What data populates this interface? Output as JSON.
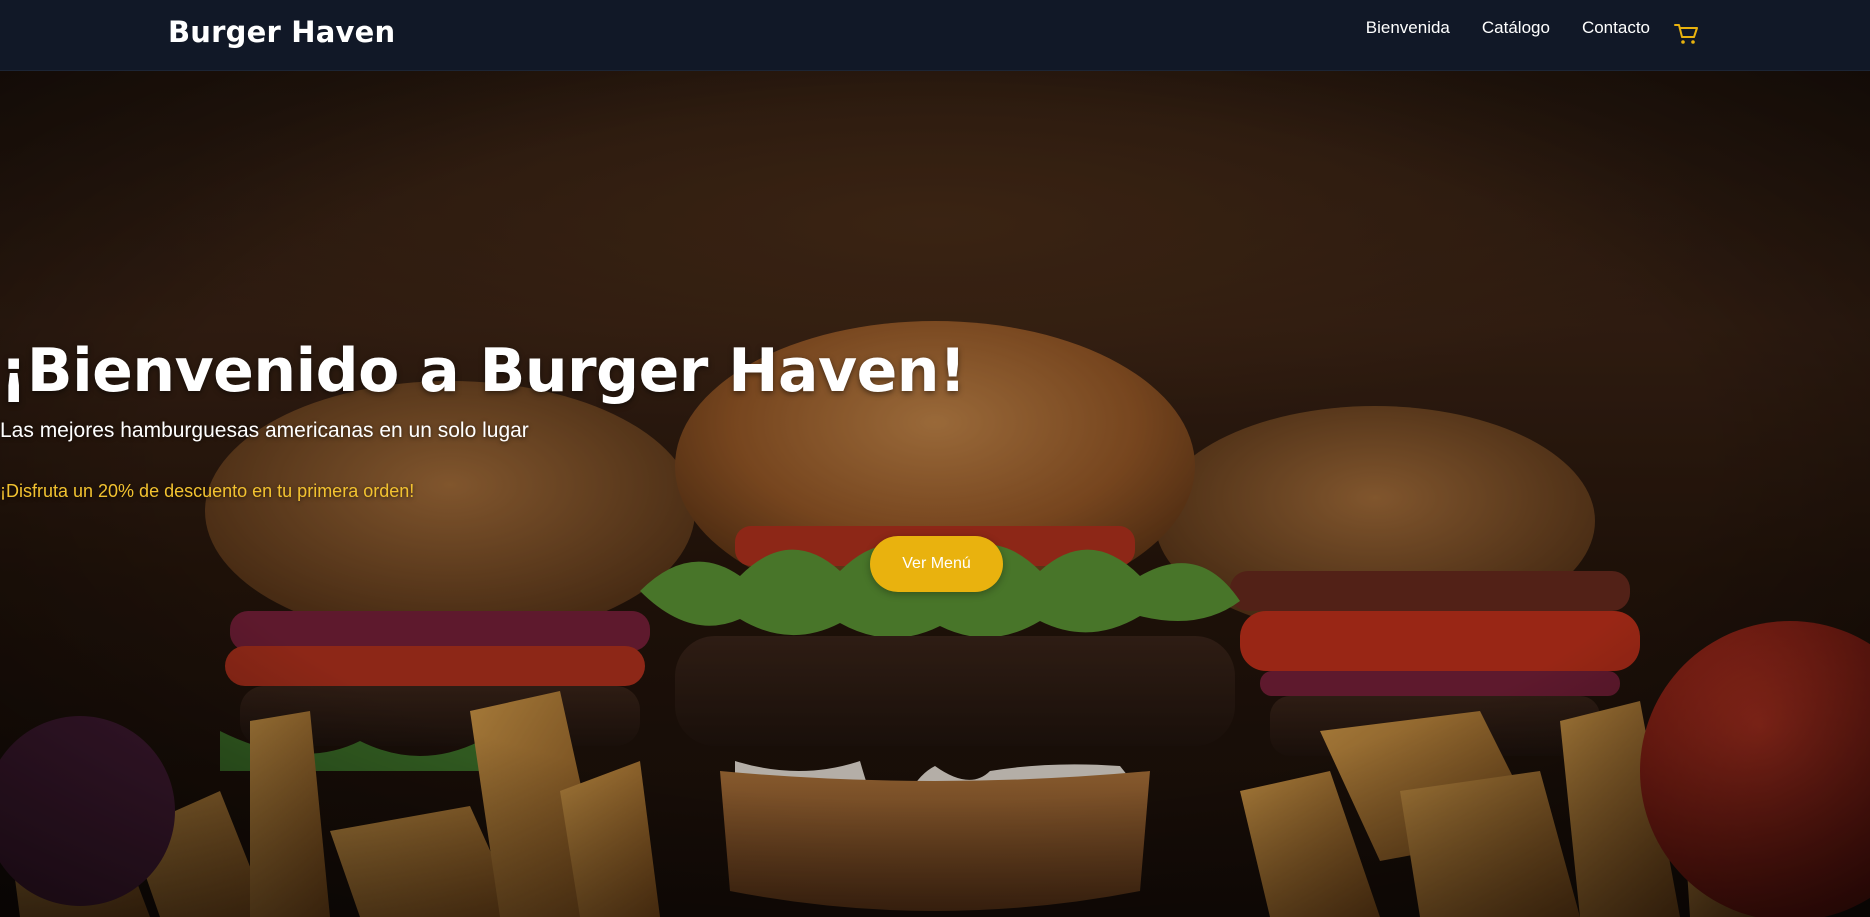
{
  "nav": {
    "brand": "Burger Haven",
    "links": [
      {
        "label": "Bienvenida"
      },
      {
        "label": "Catálogo"
      },
      {
        "label": "Contacto"
      }
    ],
    "cart_icon": "cart-icon",
    "cart_icon_color": "#e9b20e",
    "background_color": "#111827"
  },
  "hero": {
    "title": "¡Bienvenido a Burger Haven!",
    "subtitle": "Las mejores hamburguesas americanas en un solo lugar",
    "promo": "¡Disfruta un 20% de descuento en tu primera orden!",
    "cta_label": "Ver Menú",
    "accent_color": "#e9b20e",
    "promo_color": "#f2c230"
  }
}
